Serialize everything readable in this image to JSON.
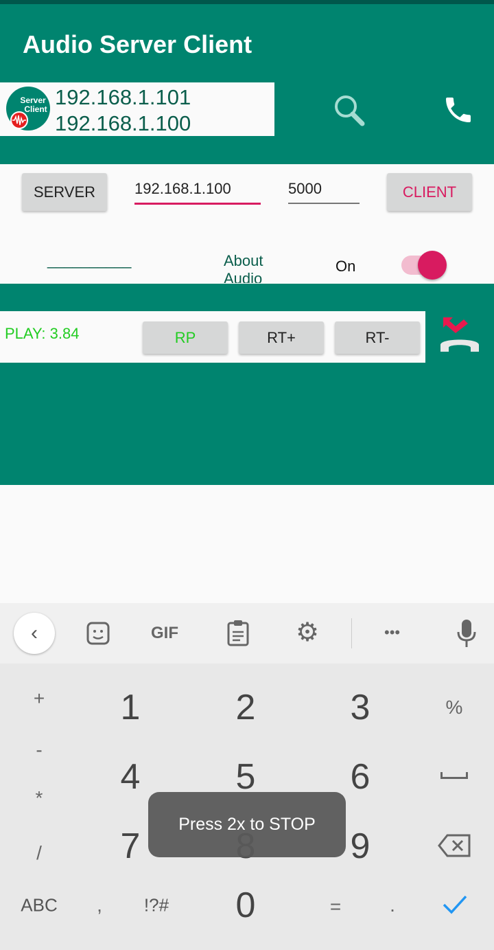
{
  "app_bar": {
    "title": "Audio Server Client"
  },
  "header": {
    "ip_local": "192.168.1.101",
    "ip_remote": "192.168.1.100",
    "logo_text": "Server Client"
  },
  "controls": {
    "server_label": "SERVER",
    "ip_value": "192.168.1.100",
    "port_value": "5000",
    "client_label": "CLIENT",
    "blank_text": "__________",
    "about_text": "About Audio",
    "switch_label": "On",
    "switch_on": true
  },
  "playback": {
    "status": "PLAY: 3.84",
    "rp_label": "RP",
    "rtplus_label": "RT+",
    "rtminus_label": "RT-"
  },
  "keyboard": {
    "toolbar": {
      "gif_label": "GIF",
      "more_label": "•••"
    },
    "keys": {
      "k1": "1",
      "k2": "2",
      "k3": "3",
      "k4": "4",
      "k5": "5",
      "k6": "6",
      "k7": "7",
      "k8": "8",
      "k9": "9",
      "k0": "0",
      "plus": "+",
      "minus": "-",
      "star": "*",
      "slash": "/",
      "percent": "%",
      "abc": "ABC",
      "comma": ",",
      "sym": "!?#",
      "equals": "=",
      "dot": "."
    }
  },
  "toast": {
    "text": "Press 2x to STOP"
  },
  "colors": {
    "primary": "#00846f",
    "accent": "#d81b60",
    "play_green": "#22cc22"
  }
}
